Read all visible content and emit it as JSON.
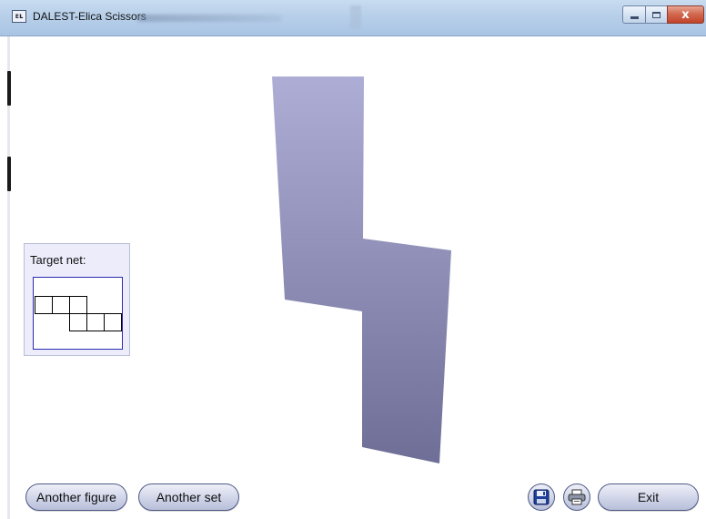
{
  "window": {
    "title": "DALEST-Elica Scissors",
    "icon": "app-logo-icon",
    "icon_text": "ᴇʟ",
    "controls": {
      "minimize_icon": "minimize-icon",
      "maximize_icon": "maximize-icon",
      "close_icon": "close-icon",
      "close_glyph": "x"
    }
  },
  "target_net": {
    "label": "Target net:",
    "grid": {
      "rows": 2,
      "cols": 5,
      "cells": [
        [
          0,
          0
        ],
        [
          0,
          1
        ],
        [
          0,
          2
        ],
        [
          1,
          2
        ],
        [
          1,
          3
        ],
        [
          1,
          4
        ]
      ]
    }
  },
  "figure": {
    "description_colors": {
      "top": "#adadd6",
      "bottom": "#6e6e96"
    }
  },
  "buttons": {
    "another_figure": "Another figure",
    "another_set": "Another set",
    "save_icon": "floppy-disk-icon",
    "print_icon": "printer-icon",
    "exit": "Exit"
  },
  "colors": {
    "titlebar": "#b7cfe9",
    "net_panel_bg": "#ececfb",
    "net_border": "#2b2bb0",
    "button_border": "#4e5a86",
    "close_red": "#c2432a"
  }
}
